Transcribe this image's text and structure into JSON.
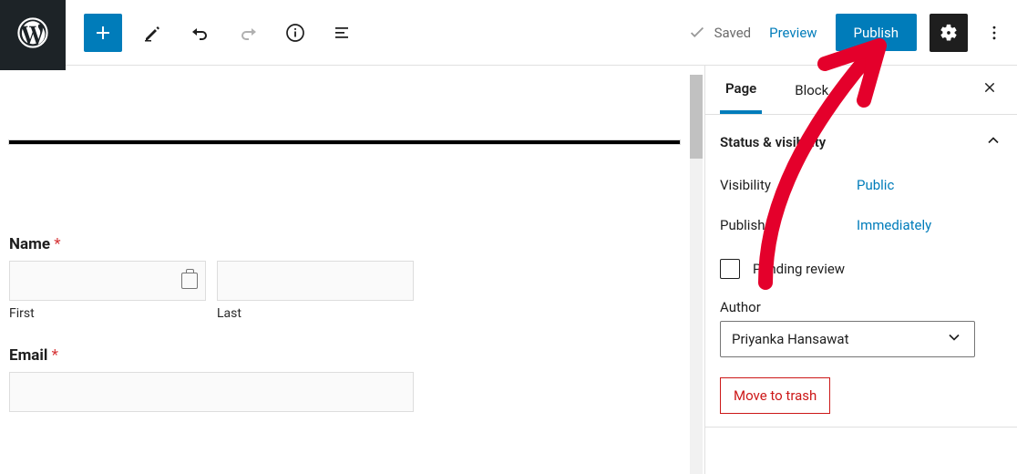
{
  "topbar": {
    "saved_label": "Saved",
    "preview_label": "Preview",
    "publish_label": "Publish"
  },
  "sidebar": {
    "tabs": {
      "page": "Page",
      "block": "Block"
    },
    "status_panel_title": "Status & visibility",
    "visibility_label": "Visibility",
    "visibility_value": "Public",
    "publish_label": "Publish",
    "publish_value": "Immediately",
    "pending_review_label": "Pending review",
    "author_label": "Author",
    "author_value": "Priyanka Hansawat",
    "trash_label": "Move to trash"
  },
  "form": {
    "name_label": "Name",
    "required_mark": "*",
    "first_sub": "First",
    "last_sub": "Last",
    "email_label": "Email"
  }
}
